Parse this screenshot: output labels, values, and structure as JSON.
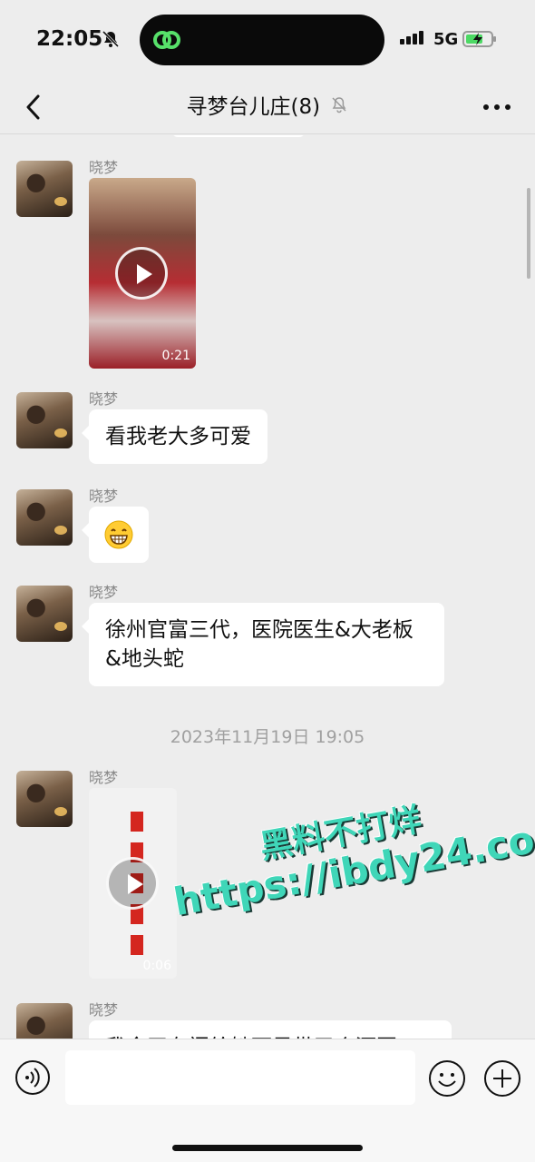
{
  "status_bar": {
    "time": "22:05",
    "network": "5G",
    "icons": [
      "bell-slash-icon",
      "app-link-icon",
      "signal-icon",
      "battery-charging-icon"
    ]
  },
  "header": {
    "title": "寻梦台儿庄(8)",
    "back_icon": "chevron-left-icon",
    "mute_icon": "bell-slash-icon",
    "more_icon": "more-dots-icon"
  },
  "messages": [
    {
      "sender": "晓梦",
      "type": "video",
      "duration": "0:21"
    },
    {
      "sender": "晓梦",
      "type": "text",
      "text": "看我老大多可爱"
    },
    {
      "sender": "晓梦",
      "type": "emoji",
      "emoji": "😁"
    },
    {
      "sender": "晓梦",
      "type": "text",
      "text": "徐州官富三代，医院医生&大老板&地头蛇"
    },
    {
      "type": "timestamp",
      "text": "2023年11月19日 19:05"
    },
    {
      "sender": "晓梦",
      "type": "video",
      "duration": "0:06"
    },
    {
      "sender": "晓梦",
      "type": "text",
      "text": "我今天在门给她可是带了个酒回"
    }
  ],
  "watermark": {
    "line1": "黑料不打烊",
    "line2": "https://ibdy24.com"
  },
  "input_bar": {
    "voice_icon": "voice-icon",
    "emoji_icon": "emoji-icon",
    "plus_icon": "plus-circle-icon",
    "placeholder": ""
  },
  "colors": {
    "background": "#ededed",
    "bubble": "#ffffff",
    "watermark": "#3fd6b8"
  }
}
